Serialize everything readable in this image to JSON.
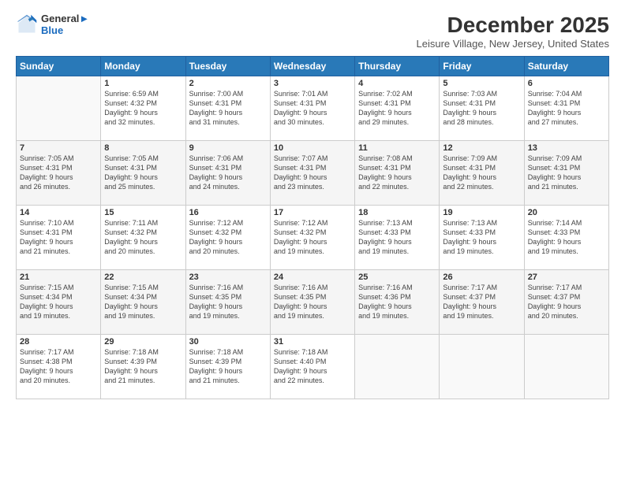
{
  "logo": {
    "line1": "General",
    "line2": "Blue"
  },
  "title": "December 2025",
  "subtitle": "Leisure Village, New Jersey, United States",
  "weekdays": [
    "Sunday",
    "Monday",
    "Tuesday",
    "Wednesday",
    "Thursday",
    "Friday",
    "Saturday"
  ],
  "weeks": [
    [
      {
        "day": "",
        "info": ""
      },
      {
        "day": "1",
        "info": "Sunrise: 6:59 AM\nSunset: 4:32 PM\nDaylight: 9 hours\nand 32 minutes."
      },
      {
        "day": "2",
        "info": "Sunrise: 7:00 AM\nSunset: 4:31 PM\nDaylight: 9 hours\nand 31 minutes."
      },
      {
        "day": "3",
        "info": "Sunrise: 7:01 AM\nSunset: 4:31 PM\nDaylight: 9 hours\nand 30 minutes."
      },
      {
        "day": "4",
        "info": "Sunrise: 7:02 AM\nSunset: 4:31 PM\nDaylight: 9 hours\nand 29 minutes."
      },
      {
        "day": "5",
        "info": "Sunrise: 7:03 AM\nSunset: 4:31 PM\nDaylight: 9 hours\nand 28 minutes."
      },
      {
        "day": "6",
        "info": "Sunrise: 7:04 AM\nSunset: 4:31 PM\nDaylight: 9 hours\nand 27 minutes."
      }
    ],
    [
      {
        "day": "7",
        "info": "Sunrise: 7:05 AM\nSunset: 4:31 PM\nDaylight: 9 hours\nand 26 minutes."
      },
      {
        "day": "8",
        "info": "Sunrise: 7:05 AM\nSunset: 4:31 PM\nDaylight: 9 hours\nand 25 minutes."
      },
      {
        "day": "9",
        "info": "Sunrise: 7:06 AM\nSunset: 4:31 PM\nDaylight: 9 hours\nand 24 minutes."
      },
      {
        "day": "10",
        "info": "Sunrise: 7:07 AM\nSunset: 4:31 PM\nDaylight: 9 hours\nand 23 minutes."
      },
      {
        "day": "11",
        "info": "Sunrise: 7:08 AM\nSunset: 4:31 PM\nDaylight: 9 hours\nand 22 minutes."
      },
      {
        "day": "12",
        "info": "Sunrise: 7:09 AM\nSunset: 4:31 PM\nDaylight: 9 hours\nand 22 minutes."
      },
      {
        "day": "13",
        "info": "Sunrise: 7:09 AM\nSunset: 4:31 PM\nDaylight: 9 hours\nand 21 minutes."
      }
    ],
    [
      {
        "day": "14",
        "info": "Sunrise: 7:10 AM\nSunset: 4:31 PM\nDaylight: 9 hours\nand 21 minutes."
      },
      {
        "day": "15",
        "info": "Sunrise: 7:11 AM\nSunset: 4:32 PM\nDaylight: 9 hours\nand 20 minutes."
      },
      {
        "day": "16",
        "info": "Sunrise: 7:12 AM\nSunset: 4:32 PM\nDaylight: 9 hours\nand 20 minutes."
      },
      {
        "day": "17",
        "info": "Sunrise: 7:12 AM\nSunset: 4:32 PM\nDaylight: 9 hours\nand 19 minutes."
      },
      {
        "day": "18",
        "info": "Sunrise: 7:13 AM\nSunset: 4:33 PM\nDaylight: 9 hours\nand 19 minutes."
      },
      {
        "day": "19",
        "info": "Sunrise: 7:13 AM\nSunset: 4:33 PM\nDaylight: 9 hours\nand 19 minutes."
      },
      {
        "day": "20",
        "info": "Sunrise: 7:14 AM\nSunset: 4:33 PM\nDaylight: 9 hours\nand 19 minutes."
      }
    ],
    [
      {
        "day": "21",
        "info": "Sunrise: 7:15 AM\nSunset: 4:34 PM\nDaylight: 9 hours\nand 19 minutes."
      },
      {
        "day": "22",
        "info": "Sunrise: 7:15 AM\nSunset: 4:34 PM\nDaylight: 9 hours\nand 19 minutes."
      },
      {
        "day": "23",
        "info": "Sunrise: 7:16 AM\nSunset: 4:35 PM\nDaylight: 9 hours\nand 19 minutes."
      },
      {
        "day": "24",
        "info": "Sunrise: 7:16 AM\nSunset: 4:35 PM\nDaylight: 9 hours\nand 19 minutes."
      },
      {
        "day": "25",
        "info": "Sunrise: 7:16 AM\nSunset: 4:36 PM\nDaylight: 9 hours\nand 19 minutes."
      },
      {
        "day": "26",
        "info": "Sunrise: 7:17 AM\nSunset: 4:37 PM\nDaylight: 9 hours\nand 19 minutes."
      },
      {
        "day": "27",
        "info": "Sunrise: 7:17 AM\nSunset: 4:37 PM\nDaylight: 9 hours\nand 20 minutes."
      }
    ],
    [
      {
        "day": "28",
        "info": "Sunrise: 7:17 AM\nSunset: 4:38 PM\nDaylight: 9 hours\nand 20 minutes."
      },
      {
        "day": "29",
        "info": "Sunrise: 7:18 AM\nSunset: 4:39 PM\nDaylight: 9 hours\nand 21 minutes."
      },
      {
        "day": "30",
        "info": "Sunrise: 7:18 AM\nSunset: 4:39 PM\nDaylight: 9 hours\nand 21 minutes."
      },
      {
        "day": "31",
        "info": "Sunrise: 7:18 AM\nSunset: 4:40 PM\nDaylight: 9 hours\nand 22 minutes."
      },
      {
        "day": "",
        "info": ""
      },
      {
        "day": "",
        "info": ""
      },
      {
        "day": "",
        "info": ""
      }
    ]
  ]
}
